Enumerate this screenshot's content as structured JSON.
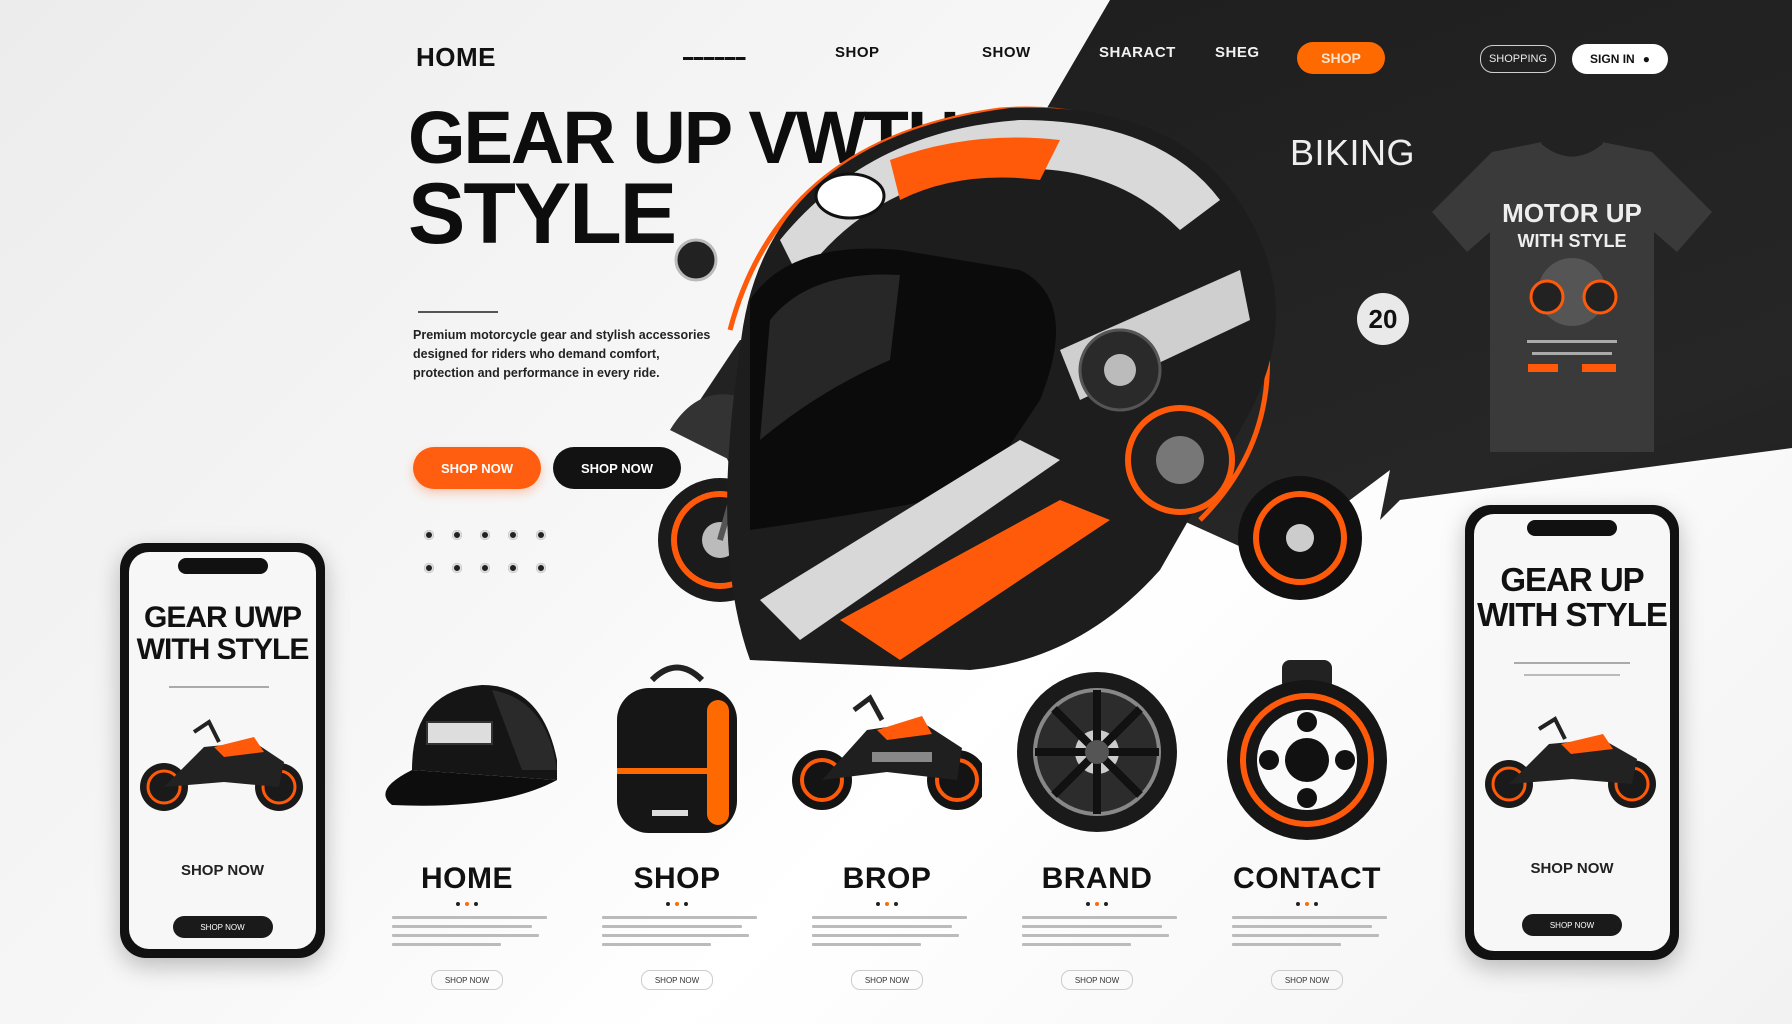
{
  "colors": {
    "accent": "#ff6a00",
    "dark": "#121212",
    "light_bg": "#f5f5f5"
  },
  "nav": {
    "home": "HOME",
    "item_2": "SHOP",
    "item_3": "SHOW",
    "item_4": "SHARACT",
    "item_5": "SHEG",
    "cta": "SHOP",
    "outline_pill": "SHOPPING",
    "white_pill": "SIGN IN"
  },
  "hero": {
    "title_line1": "GEAR UP VWTH",
    "title_line2": "STYLE",
    "paragraph": "Premium motorcycle gear and stylish accessories designed for riders who demand comfort, protection and performance in every ride.",
    "btn_primary": "SHOP NOW",
    "btn_secondary": "SHOP NOW",
    "side_label": "BIKING",
    "badge": "20"
  },
  "tshirt": {
    "print_line1": "MOTOR UP",
    "print_line2": "WITH STYLE"
  },
  "phone_left": {
    "title_line1": "GEAR UWP",
    "title_line2": "WITH STYLE",
    "cta": "SHOP NOW",
    "button": "SHOP NOW"
  },
  "phone_right": {
    "title_line1": "GEAR UP",
    "title_line2": "WITH STYLE",
    "cta": "SHOP NOW",
    "button": "SHOP NOW"
  },
  "products": [
    {
      "label": "HOME",
      "icon": "cap-icon",
      "link": "SHOP NOW"
    },
    {
      "label": "SHOP",
      "icon": "backpack-icon",
      "link": "SHOP NOW"
    },
    {
      "label": "BROP",
      "icon": "motorcycle-icon",
      "link": "SHOP NOW"
    },
    {
      "label": "BRAND",
      "icon": "wheel-icon",
      "link": "SHOP NOW"
    },
    {
      "label": "CONTACT",
      "icon": "brake-disc-icon",
      "link": "SHOP NOW"
    }
  ]
}
